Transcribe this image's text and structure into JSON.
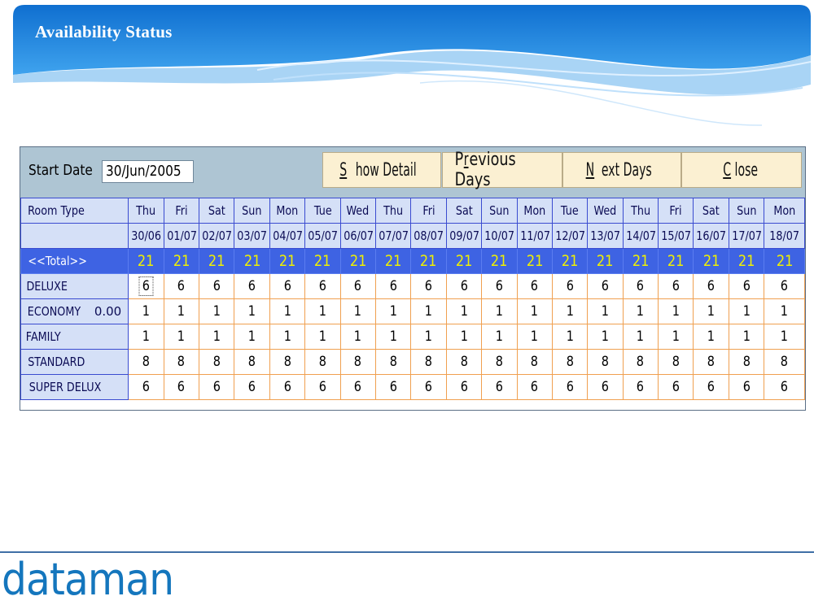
{
  "slide": {
    "title": "Availability Status",
    "logo_text": "dataman"
  },
  "toolbar": {
    "start_date_label": "Start Date",
    "start_date_value": "30/Jun/2005",
    "buttons": [
      {
        "label": "Show Detail",
        "mnemonic": "S"
      },
      {
        "label": "Previous Days",
        "mnemonic": "r"
      },
      {
        "label": "Next Days",
        "mnemonic": "N"
      },
      {
        "label": "Close",
        "mnemonic": "C"
      }
    ]
  },
  "grid": {
    "room_type_header": "Room Type",
    "days": [
      "Thu",
      "Fri",
      "Sat",
      "Sun",
      "Mon",
      "Tue",
      "Wed",
      "Thu",
      "Fri",
      "Sat",
      "Sun",
      "Mon",
      "Tue",
      "Wed",
      "Thu",
      "Fri",
      "Sat",
      "Sun",
      "Mon"
    ],
    "dates": [
      "30/06",
      "01/07",
      "02/07",
      "03/07",
      "04/07",
      "05/07",
      "06/07",
      "07/07",
      "08/07",
      "09/07",
      "10/07",
      "11/07",
      "12/07",
      "13/07",
      "14/07",
      "15/07",
      "16/07",
      "17/07",
      "18/07"
    ],
    "total_label": "<<Total>>",
    "totals": [
      "21",
      "21",
      "21",
      "21",
      "21",
      "21",
      "21",
      "21",
      "21",
      "21",
      "21",
      "21",
      "21",
      "21",
      "21",
      "21",
      "21",
      "21",
      "21"
    ],
    "rows": [
      {
        "name": "DELUXE",
        "extra": "",
        "values": [
          "6",
          "6",
          "6",
          "6",
          "6",
          "6",
          "6",
          "6",
          "6",
          "6",
          "6",
          "6",
          "6",
          "6",
          "6",
          "6",
          "6",
          "6",
          "6"
        ]
      },
      {
        "name": "ECONOMY",
        "extra": "0.00",
        "values": [
          "1",
          "1",
          "1",
          "1",
          "1",
          "1",
          "1",
          "1",
          "1",
          "1",
          "1",
          "1",
          "1",
          "1",
          "1",
          "1",
          "1",
          "1",
          "1"
        ]
      },
      {
        "name": "FAMILY",
        "extra": "",
        "values": [
          "1",
          "1",
          "1",
          "1",
          "1",
          "1",
          "1",
          "1",
          "1",
          "1",
          "1",
          "1",
          "1",
          "1",
          "1",
          "1",
          "1",
          "1",
          "1"
        ]
      },
      {
        "name": "STANDARD",
        "extra": "",
        "values": [
          "8",
          "8",
          "8",
          "8",
          "8",
          "8",
          "8",
          "8",
          "8",
          "8",
          "8",
          "8",
          "8",
          "8",
          "8",
          "8",
          "8",
          "8",
          "8"
        ]
      },
      {
        "name": "SUPER DELUX",
        "extra": "",
        "values": [
          "6",
          "6",
          "6",
          "6",
          "6",
          "6",
          "6",
          "6",
          "6",
          "6",
          "6",
          "6",
          "6",
          "6",
          "6",
          "6",
          "6",
          "6",
          "6"
        ]
      }
    ]
  },
  "colors": {
    "banner": "#1a7fd6",
    "total_row": "#3e63e3",
    "total_text": "#f0f000",
    "cell_border": "#f0a050",
    "toolbar": "#aec5d3",
    "button": "#fbf0d2",
    "logo": "#1476bd"
  }
}
